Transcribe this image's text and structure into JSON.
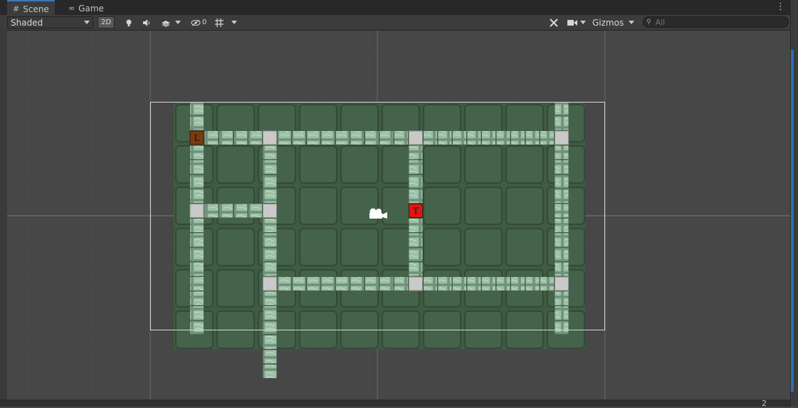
{
  "tabs": [
    {
      "label": "Scene",
      "icon": "grid-icon",
      "active": true
    },
    {
      "label": "Game",
      "icon": "gamepad-icon",
      "active": false
    }
  ],
  "toolbar": {
    "shading_mode": "Shaded",
    "mode_2d": "2D",
    "hidden_count": "0",
    "gizmos_label": "Gizmos",
    "search_placeholder": "All"
  },
  "scene": {
    "background_color": "#474747",
    "floor_color": "#3f5b40",
    "tile_color": "#8fb59a",
    "junction_color": "#c9c9c9",
    "marker_l": {
      "label": "L",
      "color": "#7a3b12"
    },
    "marker_t": {
      "label": "T",
      "color": "#e01515"
    },
    "camera_frame_color": "#d8d8d8",
    "icons": [
      "camera-gizmo-icon"
    ]
  },
  "status_text": "2"
}
